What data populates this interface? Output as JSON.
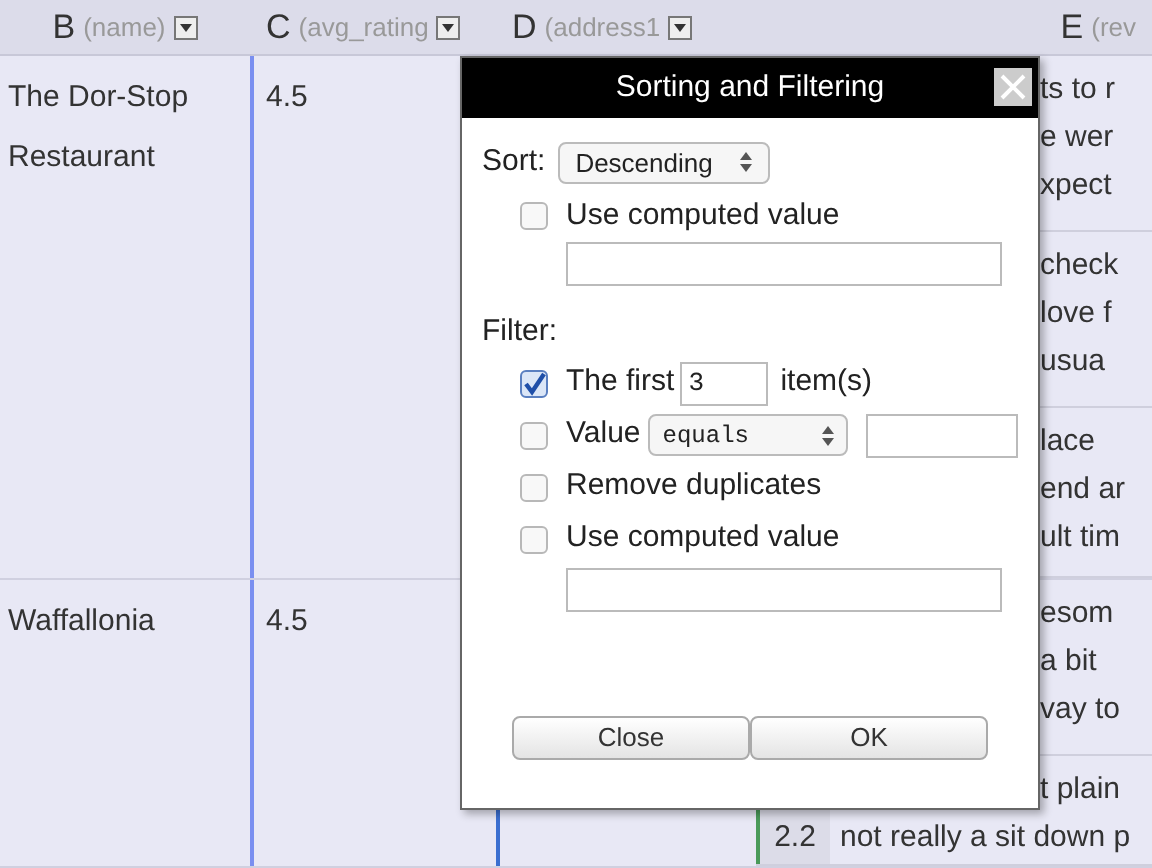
{
  "columns": [
    {
      "letter": "B",
      "field": "(name)"
    },
    {
      "letter": "C",
      "field": "(avg_rating"
    },
    {
      "letter": "D",
      "field": "(address1"
    },
    {
      "letter": "E",
      "field": "(rev"
    }
  ],
  "rows": [
    {
      "name": [
        "The Dor-Stop",
        "Restaurant"
      ],
      "rating": "4.5",
      "reviews": [
        {
          "lines": [
            "ts to r",
            "e wer",
            "xpect"
          ]
        },
        {
          "lines": [
            "check",
            "love f",
            "usua"
          ]
        },
        {
          "lines": [
            "lace",
            "end ar",
            "ult tim"
          ]
        }
      ]
    },
    {
      "name": [
        "Waffallonia"
      ],
      "rating": "4.5",
      "reviews": [
        {
          "lines": [
            "esom",
            "a bit",
            "vay to"
          ]
        },
        {
          "score": "2.2",
          "lines": [
            "t plain",
            "not really a sit down p"
          ]
        }
      ]
    }
  ],
  "dialog": {
    "title": "Sorting and Filtering",
    "sort_label": "Sort:",
    "sort_value": "Descending",
    "sort_computed": {
      "label": "Use computed value",
      "checked": false
    },
    "filter_label": "Filter:",
    "filters": [
      {
        "kind": "first",
        "checked": true,
        "label": "The first",
        "value": "3",
        "suffix": "item(s)"
      },
      {
        "kind": "value",
        "checked": false,
        "label": "Value",
        "operator": "equals"
      },
      {
        "kind": "plain",
        "checked": false,
        "label": "Remove duplicates"
      },
      {
        "kind": "computed",
        "checked": false,
        "label": "Use computed value"
      }
    ],
    "buttons": [
      "Close",
      "OK"
    ]
  }
}
